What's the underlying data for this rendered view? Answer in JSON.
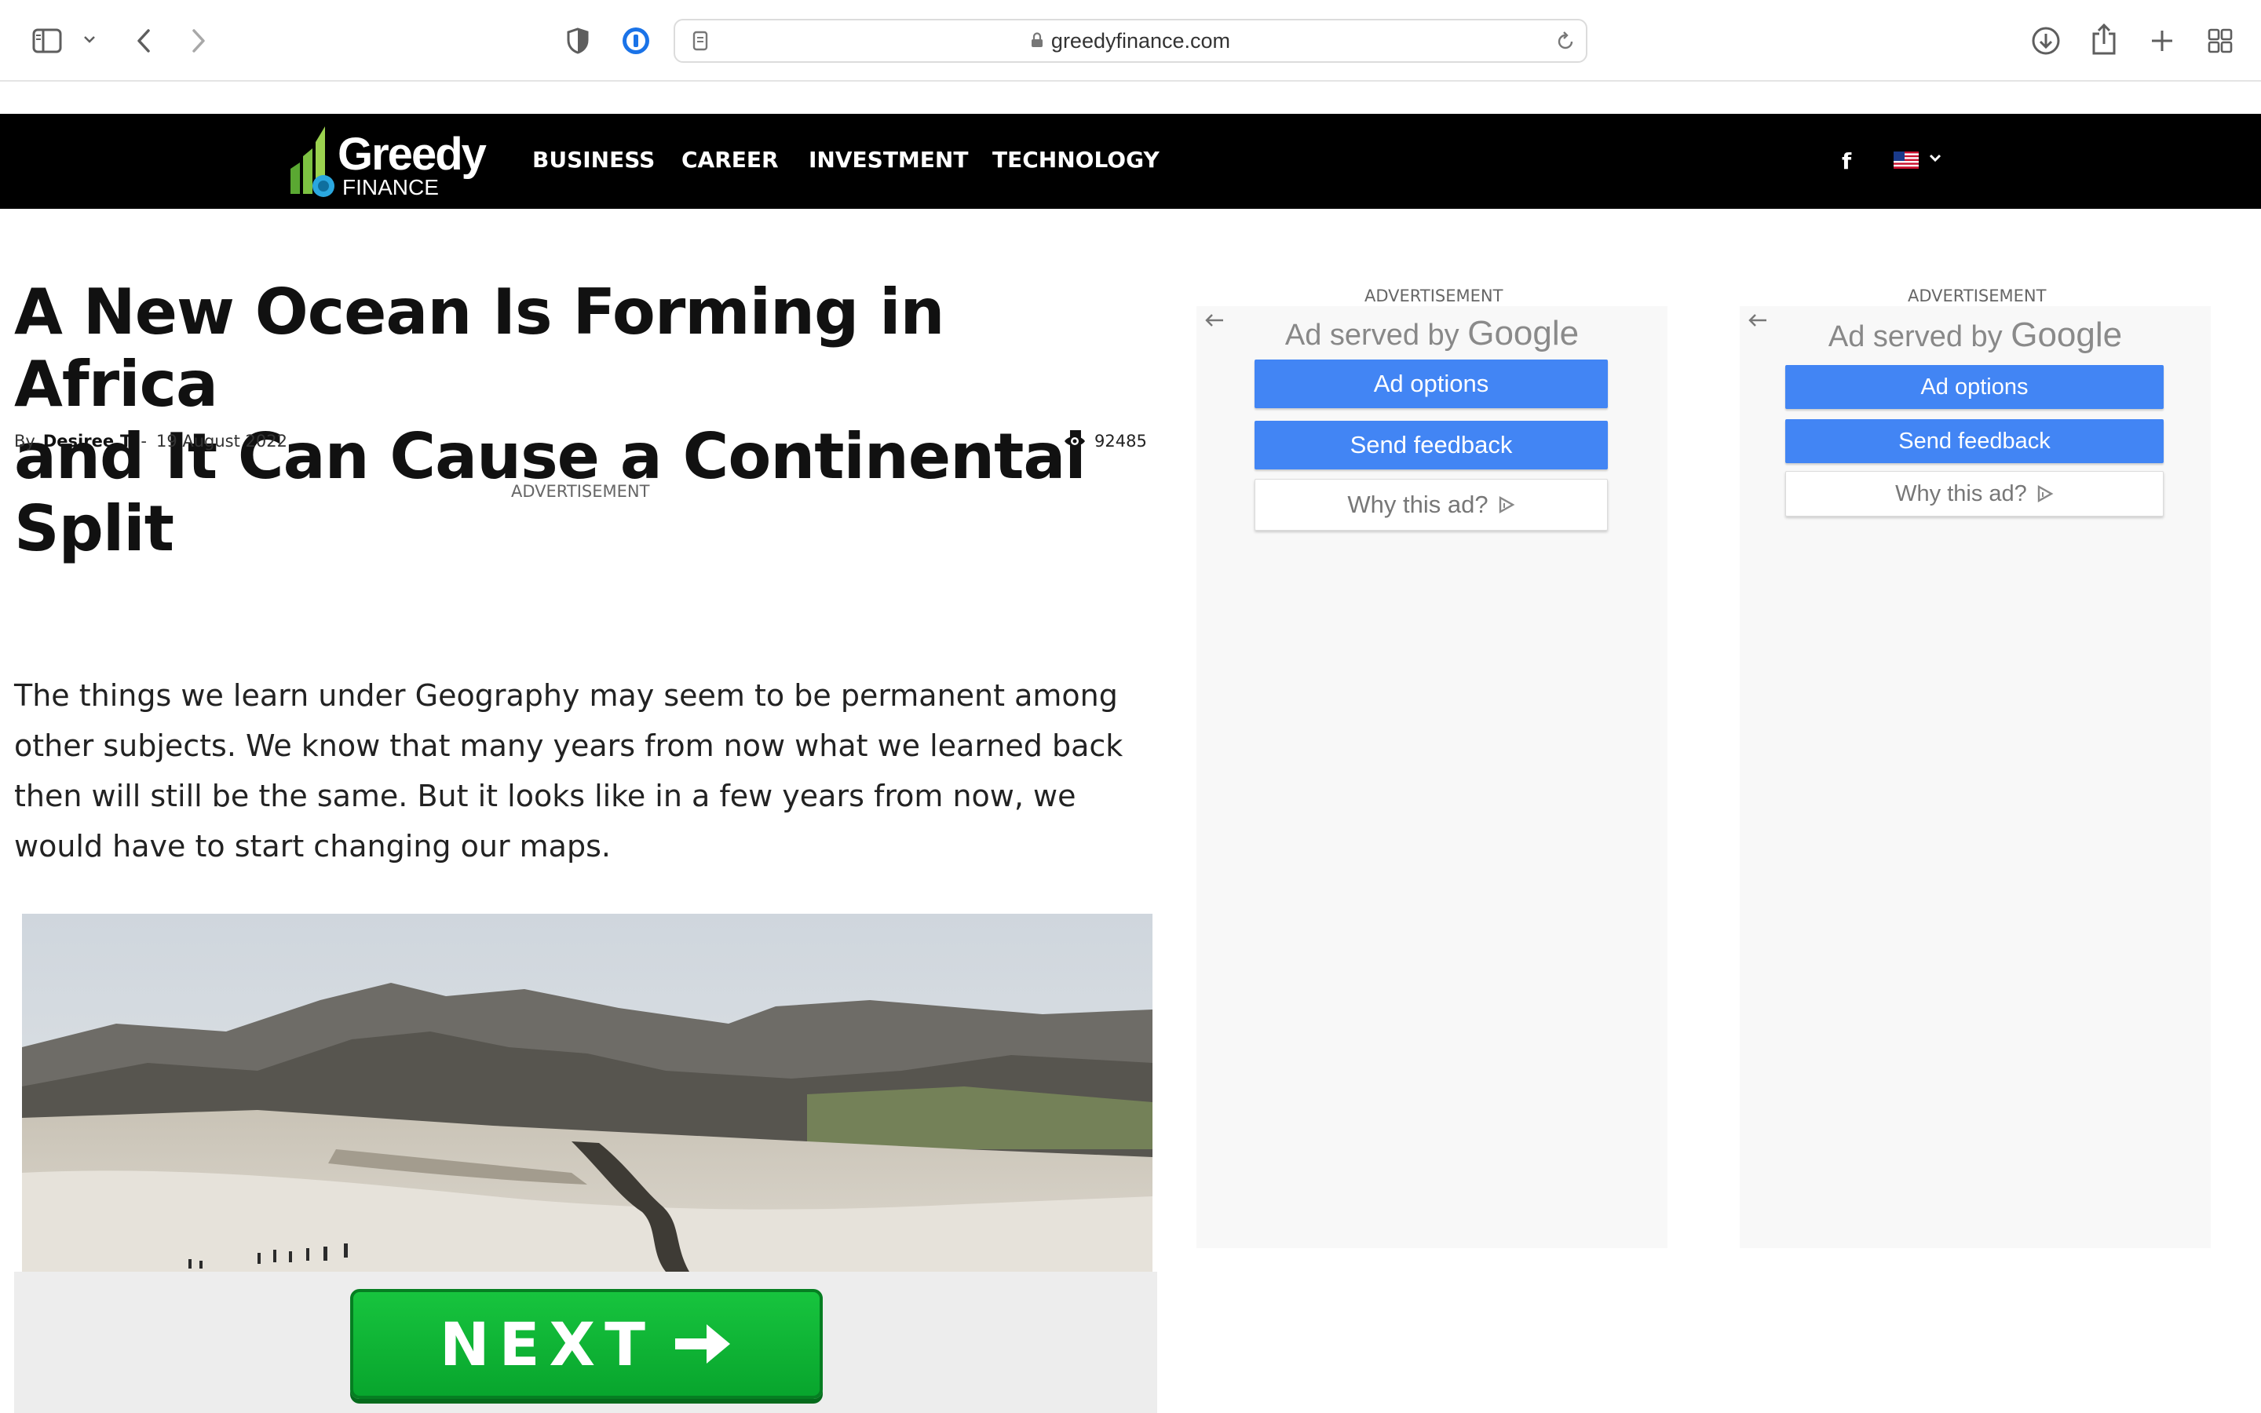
{
  "browser": {
    "url": "greedyfinance.com",
    "icons": [
      "sidebar-icon",
      "chevron-down-icon",
      "back-icon",
      "forward-icon",
      "privacy-shield-icon",
      "password-manager-icon",
      "page-icon",
      "lock-icon",
      "reload-icon",
      "download-icon",
      "share-icon",
      "new-tab-icon",
      "tab-overview-icon"
    ]
  },
  "site": {
    "logo_word": "Greedy",
    "logo_sub": "FINANCE",
    "nav": [
      "BUSINESS",
      "CAREER",
      "INVESTMENT",
      "TECHNOLOGY"
    ],
    "facebook": "f",
    "language_flag": "us-flag-icon"
  },
  "article": {
    "title_line1": "A New Ocean Is Forming in Africa",
    "title_line2": "and It Can Cause a Continental Split",
    "by_label": "By",
    "author": "Desiree.T",
    "separator": "-",
    "date": "19 August 2022",
    "views": "92485",
    "ad_label": "ADVERTISEMENT",
    "body": "The things we learn under Geography may seem to be permanent among other subjects. We know that many years from now what we learned back then will still be the same. But it looks like in a few years from now, we would have to start changing our maps.",
    "next_label": "NEXT"
  },
  "ads": [
    {
      "label": "ADVERTISEMENT",
      "served_prefix": "Ad served by",
      "served_brand": "Google",
      "options": "Ad options",
      "feedback": "Send feedback",
      "why": "Why this ad?"
    },
    {
      "label": "ADVERTISEMENT",
      "served_prefix": "Ad served by",
      "served_brand": "Google",
      "options": "Ad options",
      "feedback": "Send feedback",
      "why": "Why this ad?"
    }
  ],
  "colors": {
    "nav_bg": "#000000",
    "ad_button": "#4285f4",
    "next_button": "#0db434",
    "logo_green": "#7dc142"
  }
}
